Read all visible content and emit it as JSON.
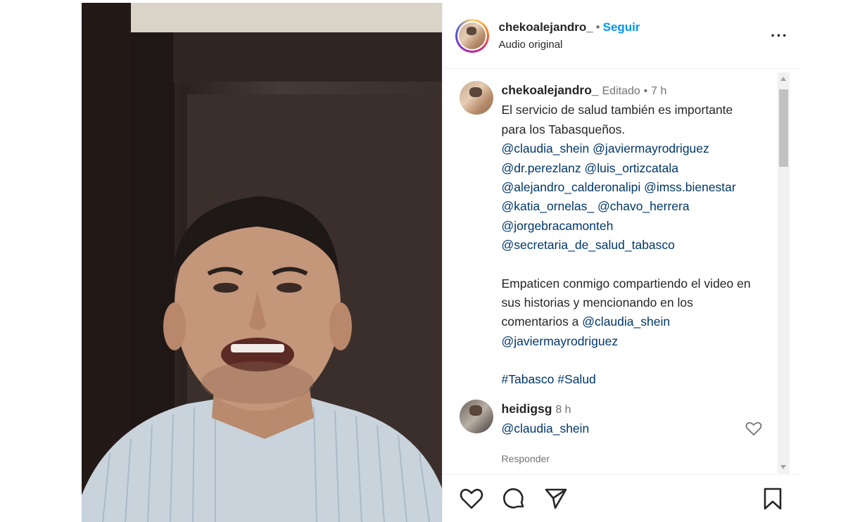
{
  "post": {
    "username": "chekoalejandro_",
    "follow_label": "Seguir",
    "audio_label": "Audio original",
    "more_icon": "more-horizontal-icon"
  },
  "caption": {
    "username": "chekoalejandro_",
    "edited": "Editado",
    "time": "7 h",
    "line1": "El servicio de salud también es importante para los Tabasqueños.",
    "mentions": [
      "@claudia_shein",
      "@javiermayrodriguez",
      "@dr.perezlanz",
      "@luis_ortizcatala",
      "@alejandro_calderonalipi",
      "@imss.bienestar",
      "@katia_ornelas_",
      "@chavo_herrera",
      "@jorgebracamonteh",
      "@secretaria_de_salud_tabasco"
    ],
    "line2": "Empaticen conmigo compartiendo el video en sus historias y mencionando en los comentarios a",
    "line2_mentions": [
      "@claudia_shein",
      "@javiermayrodriguez"
    ],
    "hashtags": [
      "#Tabasco",
      "#Salud"
    ]
  },
  "comment": {
    "username": "heidigsg",
    "time": "8 h",
    "text": "@claudia_shein",
    "reply_label": "Responder"
  },
  "actions": [
    "heart-icon",
    "comment-icon",
    "share-icon",
    "bookmark-icon"
  ],
  "colors": {
    "link": "#00376b",
    "follow": "#0095f6",
    "muted": "#737373"
  }
}
